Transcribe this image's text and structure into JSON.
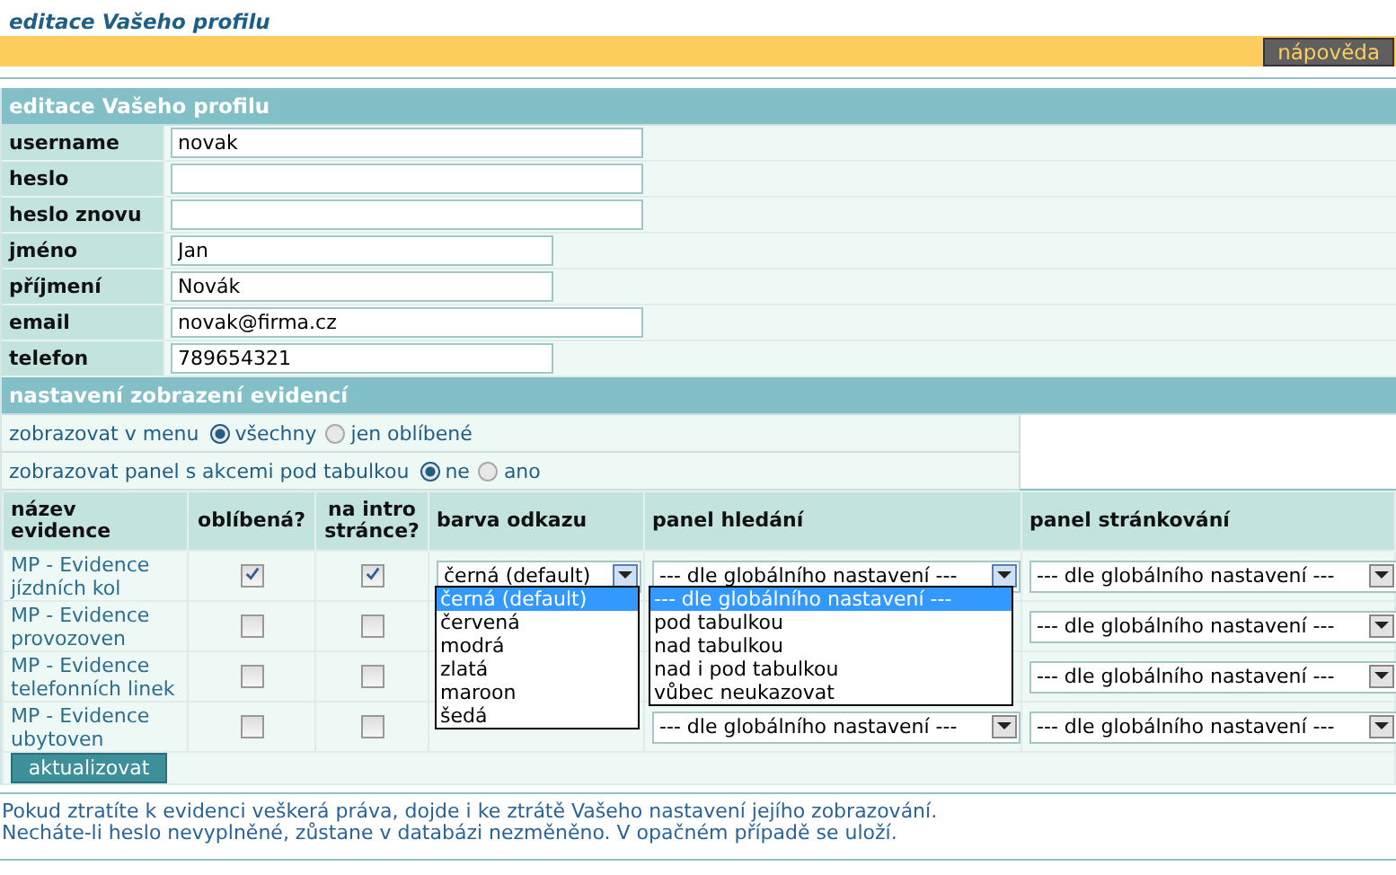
{
  "page_title": "editace Vašeho profilu",
  "help_button": "nápověda",
  "profile": {
    "title": "editace Vašeho profilu",
    "fields": [
      {
        "label": "username",
        "value": "novak",
        "wide": true
      },
      {
        "label": "heslo",
        "wide": true
      },
      {
        "label": "heslo znovu",
        "wide": true
      },
      {
        "label": "jméno",
        "value": "Jan",
        "wide": false
      },
      {
        "label": "příjmení",
        "value": "Novák",
        "wide": false
      },
      {
        "label": "email",
        "value": "novak@firma.cz",
        "wide": true
      },
      {
        "label": "telefon",
        "value": "789654321",
        "wide": false
      }
    ]
  },
  "settings": {
    "title": "nastavení zobrazení evidencí",
    "options": [
      {
        "label": "zobrazovat v menu",
        "choices": [
          {
            "label": "všechny",
            "selected": true
          },
          {
            "label": "jen oblíbené",
            "selected": false
          }
        ]
      },
      {
        "label": "zobrazovat panel s akcemi pod tabulkou",
        "choices": [
          {
            "label": "ne",
            "selected": true
          },
          {
            "label": "ano",
            "selected": false
          }
        ]
      }
    ]
  },
  "table": {
    "columns": [
      "název evidence",
      "oblíbená?",
      "na intro stránce?",
      "barva odkazu",
      "panel hledání",
      "panel stránkování"
    ],
    "rows": [
      {
        "name": "MP - Evidence jízdních kol",
        "favorite": true,
        "intro": true,
        "link_color": "černá (default)",
        "search_panel": "--- dle globálního nastavení ---",
        "paging_panel": "--- dle globálního nastavení ---"
      },
      {
        "name": "MP - Evidence provozoven",
        "favorite": false,
        "intro": false,
        "paging_panel": "--- dle globálního nastavení ---"
      },
      {
        "name": "MP - Evidence telefonních linek",
        "favorite": false,
        "intro": false,
        "paging_panel": "--- dle globálního nastavení ---"
      },
      {
        "name": "MP - Evidence ubytoven",
        "favorite": false,
        "intro": false,
        "search_panel": "--- dle globálního nastavení ---",
        "paging_panel": "--- dle globálního nastavení ---"
      }
    ]
  },
  "link_color_list": {
    "items": [
      {
        "label": "černá (default)",
        "selected": true
      },
      {
        "label": "červená",
        "selected": false
      },
      {
        "label": "modrá",
        "selected": false
      },
      {
        "label": "zlatá",
        "selected": false
      },
      {
        "label": "maroon",
        "selected": false
      },
      {
        "label": "šedá",
        "selected": false
      }
    ]
  },
  "search_panel_list": {
    "items": [
      {
        "label": "--- dle globálního nastavení ---",
        "selected": true
      },
      {
        "label": "pod tabulkou",
        "selected": false
      },
      {
        "label": "nad tabulkou",
        "selected": false
      },
      {
        "label": "nad i pod tabulkou",
        "selected": false
      },
      {
        "label": "vůbec neukazovat",
        "selected": false
      }
    ]
  },
  "update_button": "aktualizovat",
  "notes": [
    "Pokud ztratíte k evidenci veškerá práva, dojde i ke ztrátě Vašeho nastavení jejího zobrazování.",
    "Necháte-li heslo nevyplněné, zůstane v databázi nezměněno. V opačném případě se uloží."
  ]
}
